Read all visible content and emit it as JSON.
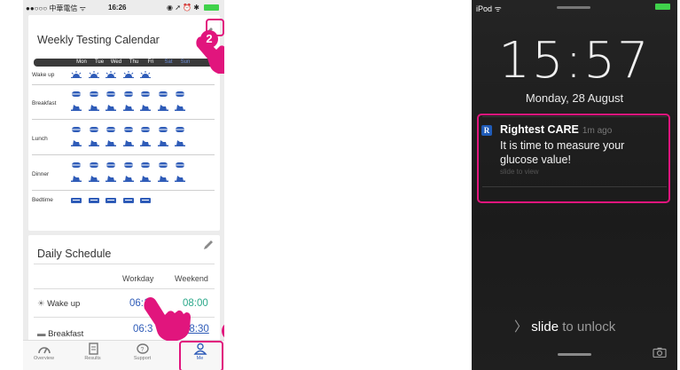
{
  "left": {
    "status": {
      "carrier": "●●○○○ 中華電信 ᯤ",
      "time": "16:26",
      "icons": "◉ ➚ ⏰ ✱"
    },
    "calendar": {
      "title": "Weekly Testing Calendar",
      "days": [
        "Mon",
        "Tue",
        "Wed",
        "Thu",
        "Fri",
        "Sat",
        "Sun"
      ],
      "rows": [
        {
          "label": "Wake up",
          "icon": "sunrise-icon",
          "days_on": 5
        },
        {
          "label": "Breakfast",
          "icon": "meal-icons",
          "days_on": 7
        },
        {
          "label": "Lunch",
          "icon": "meal-icons",
          "days_on": 7
        },
        {
          "label": "Dinner",
          "icon": "meal-icons",
          "days_on": 7
        },
        {
          "label": "Bedtime",
          "icon": "bed-icon",
          "days_on": 5
        }
      ]
    },
    "schedule": {
      "title": "Daily Schedule",
      "col_workday": "Workday",
      "col_weekend": "Weekend",
      "rows": [
        {
          "label": "Wake up",
          "workday": "06:10",
          "weekend": "08:00"
        },
        {
          "label": "Breakfast",
          "workday": "06:3",
          "weekend": "08:30"
        }
      ]
    },
    "tabs": [
      "Overview",
      "Results",
      "Support",
      "Me"
    ],
    "badges": [
      "2",
      "1"
    ]
  },
  "right": {
    "status": {
      "device": "iPod ᯤ"
    },
    "clock": "15:57",
    "date": "Monday, 28 August",
    "notification": {
      "app_icon": "R",
      "app": "Rightest CARE",
      "time": "1m ago",
      "message": "It is time to measure your glucose value!",
      "sub": "slide to view"
    },
    "unlock": {
      "arrow": "〉",
      "bold": "slide",
      "rest": " to unlock"
    }
  },
  "colors": {
    "accent": "#e1157d",
    "cal_blue": "#2f5cb8",
    "weekday_time": "#2f5cb8",
    "weekend_time": "#2ba88a"
  }
}
